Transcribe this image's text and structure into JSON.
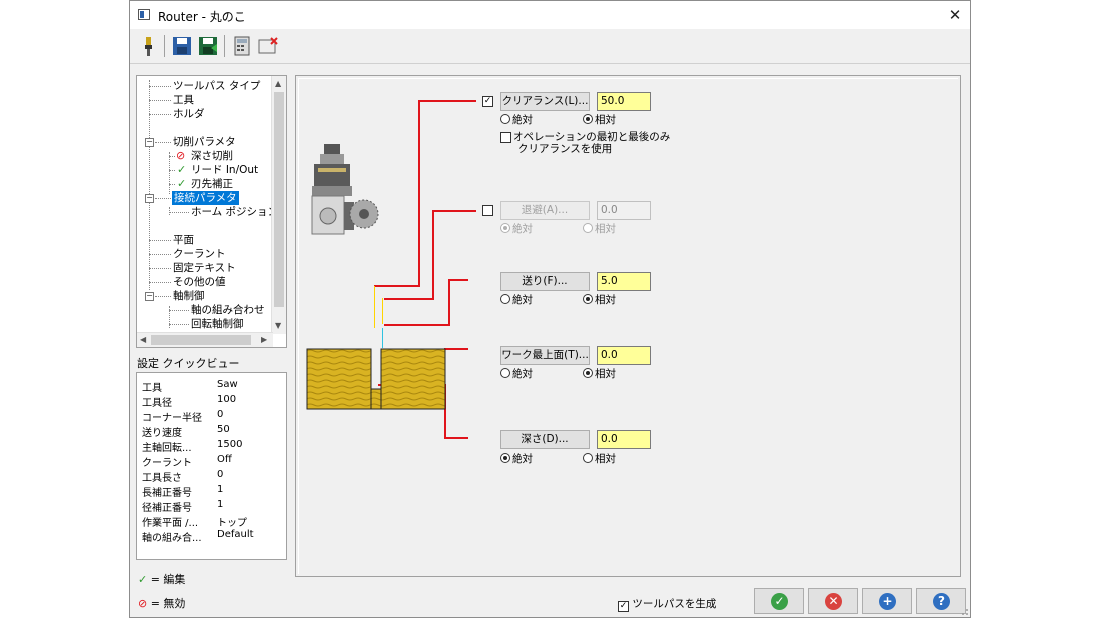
{
  "window": {
    "title": "Router - 丸のこ",
    "close_glyph": "✕"
  },
  "toolbar": {
    "icons": [
      "tool-icon",
      "save-icon",
      "save-as-icon",
      "calculator-icon",
      "delete-icon"
    ]
  },
  "tree": {
    "items": {
      "toolpath_type": "ツールパス タイプ",
      "tool": "工具",
      "holder": "ホルダ",
      "cut_params": "切削パラメタ",
      "depth_cuts": "深さ切削",
      "lead_in_out": "リード In/Out",
      "cutter_comp": "刃先補正",
      "linking_params": "接続パラメタ",
      "home_position": "ホーム ポジション/参照",
      "planes": "平面",
      "coolant": "クーラント",
      "canned_text": "固定テキスト",
      "misc_values": "その他の値",
      "axis_control": "軸制御",
      "axis_combination": "軸の組み合わせ",
      "rotary_axis_control": "回転軸制御"
    }
  },
  "quickview": {
    "label": "設定 クイックビュー",
    "rows": [
      {
        "key": "工具",
        "value": "Saw"
      },
      {
        "key": "工具径",
        "value": "100"
      },
      {
        "key": "コーナー半径",
        "value": "0"
      },
      {
        "key": "送り速度",
        "value": "50"
      },
      {
        "key": "主軸回転...",
        "value": "1500"
      },
      {
        "key": "クーラント",
        "value": "Off"
      },
      {
        "key": "工具長さ",
        "value": "0"
      },
      {
        "key": "長補正番号",
        "value": "1"
      },
      {
        "key": "径補正番号",
        "value": "1"
      },
      {
        "key": "作業平面 /...",
        "value": "トップ"
      },
      {
        "key": "軸の組み合...",
        "value": "Default"
      }
    ]
  },
  "legend": {
    "edited": "= 編集",
    "disabled": "= 無効"
  },
  "params": {
    "clearance": {
      "button": "クリアランス(L)...",
      "value": "50.0",
      "checked": true,
      "absolute": "絶対",
      "relative": "相対",
      "mode": "relative"
    },
    "clearance_option": {
      "line1": "オペレーションの最初と最後のみ",
      "line2": "クリアランスを使用",
      "checked": false
    },
    "retract": {
      "button": "退避(A)...",
      "value": "0.0",
      "checked": false,
      "absolute": "絶対",
      "relative": "相対",
      "mode": "absolute"
    },
    "feed_plane": {
      "button": "送り(F)...",
      "value": "5.0",
      "absolute": "絶対",
      "relative": "相対",
      "mode": "relative"
    },
    "top_of_stock": {
      "button": "ワーク最上面(T)...",
      "value": "0.0",
      "absolute": "絶対",
      "relative": "相対",
      "mode": "relative"
    },
    "depth": {
      "button": "深さ(D)...",
      "value": "0.0",
      "absolute": "絶対",
      "relative": "相対",
      "mode": "absolute"
    }
  },
  "footer": {
    "generate_toolpath": "ツールパスを生成",
    "generate_checked": true,
    "ok_color": "#3aa047",
    "cancel_color": "#d9433f",
    "add_color": "#2f6fc1",
    "help_color": "#2f6fc1"
  },
  "colors": {
    "selection": "#0078d7",
    "field_bg": "#ffff99",
    "guide_red": "#e0141b"
  }
}
